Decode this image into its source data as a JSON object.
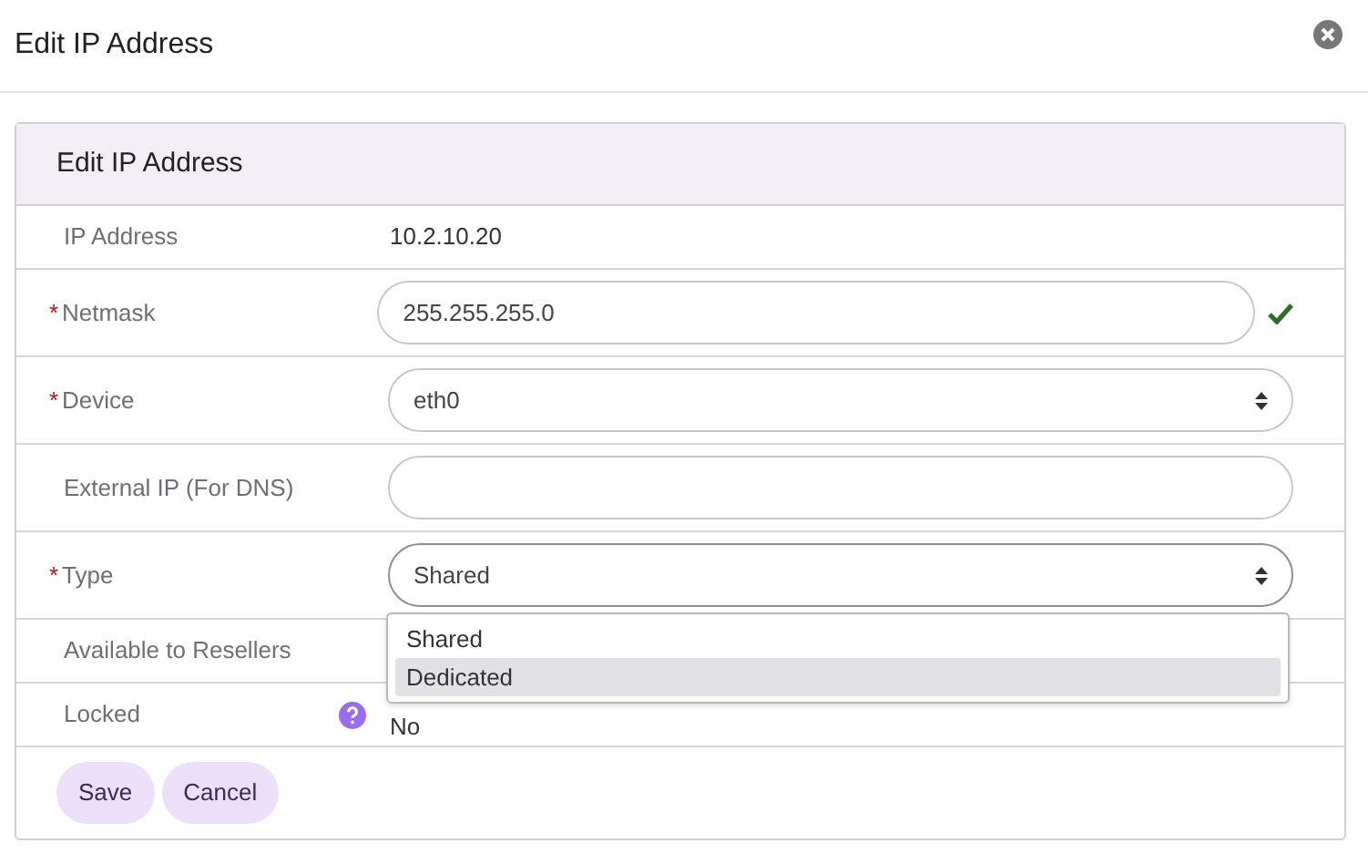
{
  "modal": {
    "title": "Edit IP Address"
  },
  "card": {
    "title": "Edit IP Address"
  },
  "fields": [
    {
      "kind": "text",
      "label": "IP Address",
      "value": "10.2.10.20"
    },
    {
      "kind": "input",
      "label": "Netmask",
      "required_mark": "*",
      "value": "255.255.255.0",
      "valid": true
    },
    {
      "kind": "select",
      "label": "Device",
      "required_mark": "*",
      "value": "eth0"
    },
    {
      "kind": "input",
      "label": "External IP (For DNS)",
      "valid": false
    },
    {
      "kind": "select",
      "label": "Type",
      "required_mark": "*",
      "value": "Shared",
      "expanded": true,
      "options": [
        {
          "label": "Shared",
          "highlighted": false
        },
        {
          "label": "Dedicated",
          "highlighted": true
        }
      ]
    },
    {
      "kind": "text",
      "label": "Available to Resellers"
    },
    {
      "kind": "text",
      "label": "Locked",
      "help": true,
      "value": "No"
    }
  ],
  "buttons": [
    "Save",
    "Cancel"
  ]
}
